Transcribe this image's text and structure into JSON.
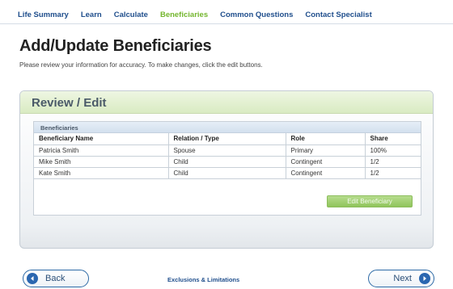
{
  "nav": {
    "items": [
      {
        "label": "Life Summary"
      },
      {
        "label": "Learn"
      },
      {
        "label": "Calculate"
      },
      {
        "label": "Beneficiaries"
      },
      {
        "label": "Common Questions"
      },
      {
        "label": "Contact Specialist"
      }
    ],
    "active_index": 3,
    "link_color": "#1f4e8c",
    "active_color": "#74b62e"
  },
  "page": {
    "title": "Add/Update Beneficiaries",
    "subtitle": "Please review your information for accuracy. To make changes, click the edit buttons."
  },
  "panel": {
    "title": "Review / Edit",
    "table_caption": "Beneficiaries",
    "columns": [
      "Beneficiary Name",
      "Relation / Type",
      "Role",
      "Share"
    ],
    "rows": [
      [
        "Patricia Smith",
        "Spouse",
        "Primary",
        "100%"
      ],
      [
        "Mike Smith",
        "Child",
        "Contingent",
        "1/2"
      ],
      [
        "Kate Smith",
        "Child",
        "Contingent",
        "1/2"
      ]
    ],
    "edit_button_label": "Edit Beneficiary"
  },
  "footer": {
    "back_label": "Back",
    "exclusions_label": "Exclusions & Limitations",
    "next_label": "Next",
    "back_icon": "arrow-left-circle-icon",
    "next_icon": "arrow-right-circle-icon"
  }
}
